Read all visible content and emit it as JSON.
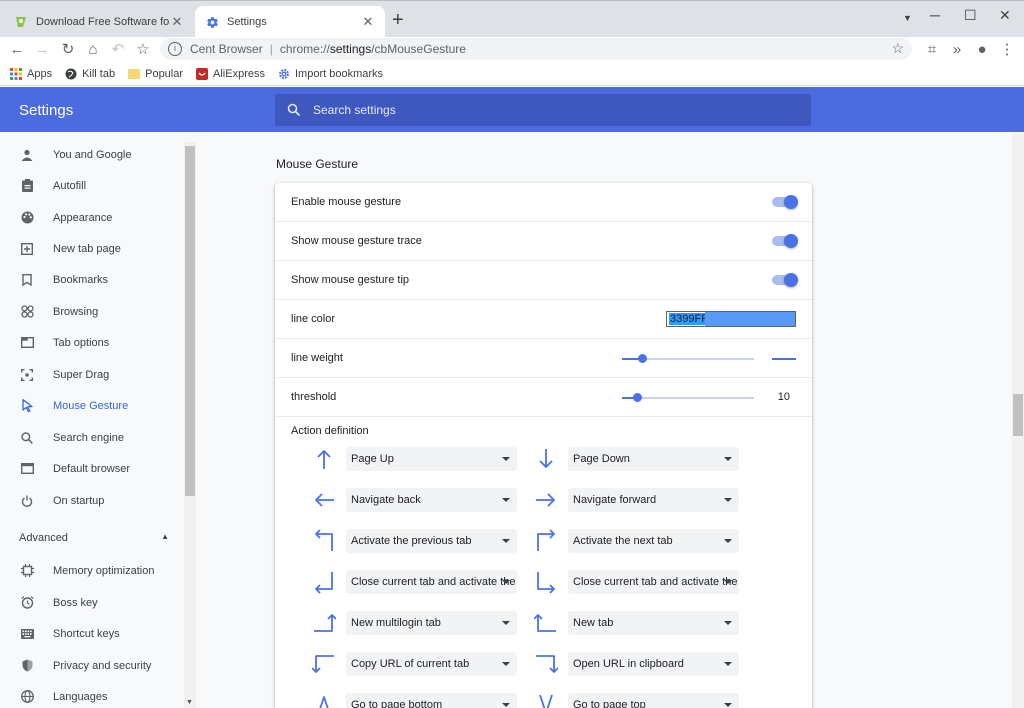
{
  "tabs": [
    {
      "title": "Download Free Software for Windows",
      "active": false
    },
    {
      "title": "Settings",
      "active": true
    }
  ],
  "toolbar": {
    "site_name": "Cent Browser",
    "url_scheme": "chrome://",
    "url_host": "settings",
    "url_path": "/cbMouseGesture"
  },
  "bookmarks": [
    {
      "label": "Apps",
      "icon": "apps-grid-icon"
    },
    {
      "label": "Kill tab",
      "icon": "globe-icon"
    },
    {
      "label": "Popular",
      "icon": "folder-icon"
    },
    {
      "label": "AliExpress",
      "icon": "aliexpress-icon"
    },
    {
      "label": "Import bookmarks",
      "icon": "gear-icon"
    }
  ],
  "header": {
    "title": "Settings",
    "search_placeholder": "Search settings",
    "color": "#4d6be0"
  },
  "sidebar": {
    "items": [
      {
        "label": "You and Google",
        "icon": "person-icon"
      },
      {
        "label": "Autofill",
        "icon": "clipboard-icon"
      },
      {
        "label": "Appearance",
        "icon": "palette-icon"
      },
      {
        "label": "New tab page",
        "icon": "new-tab-icon"
      },
      {
        "label": "Bookmarks",
        "icon": "bookmark-icon"
      },
      {
        "label": "Browsing",
        "icon": "browsing-icon"
      },
      {
        "label": "Tab options",
        "icon": "tab-icon"
      },
      {
        "label": "Super Drag",
        "icon": "drag-icon"
      },
      {
        "label": "Mouse Gesture",
        "icon": "cursor-icon",
        "selected": true
      },
      {
        "label": "Search engine",
        "icon": "search-icon"
      },
      {
        "label": "Default browser",
        "icon": "browser-icon"
      },
      {
        "label": "On startup",
        "icon": "power-icon"
      }
    ],
    "advanced_label": "Advanced",
    "advanced_items": [
      {
        "label": "Memory optimization",
        "icon": "memory-icon"
      },
      {
        "label": "Boss key",
        "icon": "alarm-icon"
      },
      {
        "label": "Shortcut keys",
        "icon": "keyboard-icon"
      },
      {
        "label": "Privacy and security",
        "icon": "shield-icon"
      },
      {
        "label": "Languages",
        "icon": "globe-icon"
      }
    ]
  },
  "main": {
    "section_title": "Mouse Gesture",
    "enable_label": "Enable mouse gesture",
    "enable_on": true,
    "trace_label": "Show mouse gesture trace",
    "trace_on": true,
    "tip_label": "Show mouse gesture tip",
    "tip_on": true,
    "line_color_label": "line color",
    "line_color_value": "3399FF",
    "line_weight_label": "line weight",
    "line_weight_fraction": 0.15,
    "threshold_label": "threshold",
    "threshold_fraction": 0.11,
    "threshold_value": "10",
    "action_title": "Action definition",
    "actions": [
      {
        "gesture": "up",
        "label": "Page Up"
      },
      {
        "gesture": "down",
        "label": "Page Down"
      },
      {
        "gesture": "left",
        "label": "Navigate back"
      },
      {
        "gesture": "right",
        "label": "Navigate forward"
      },
      {
        "gesture": "up-left",
        "label": "Activate the previous tab"
      },
      {
        "gesture": "up-right",
        "label": "Activate the next tab"
      },
      {
        "gesture": "down-left",
        "label": "Close current tab and activate the"
      },
      {
        "gesture": "down-right",
        "label": "Close current tab and activate the"
      },
      {
        "gesture": "right-up",
        "label": "New multilogin tab"
      },
      {
        "gesture": "left-up",
        "label": "New tab"
      },
      {
        "gesture": "left-down",
        "label": "Copy URL of current tab"
      },
      {
        "gesture": "right-down",
        "label": "Open URL in clipboard"
      },
      {
        "gesture": "up-down",
        "label": "Go to page bottom"
      },
      {
        "gesture": "down-up",
        "label": "Go to page top"
      }
    ]
  },
  "colors": {
    "accent": "#4a72e8",
    "selected_nav": "#3367d6"
  }
}
